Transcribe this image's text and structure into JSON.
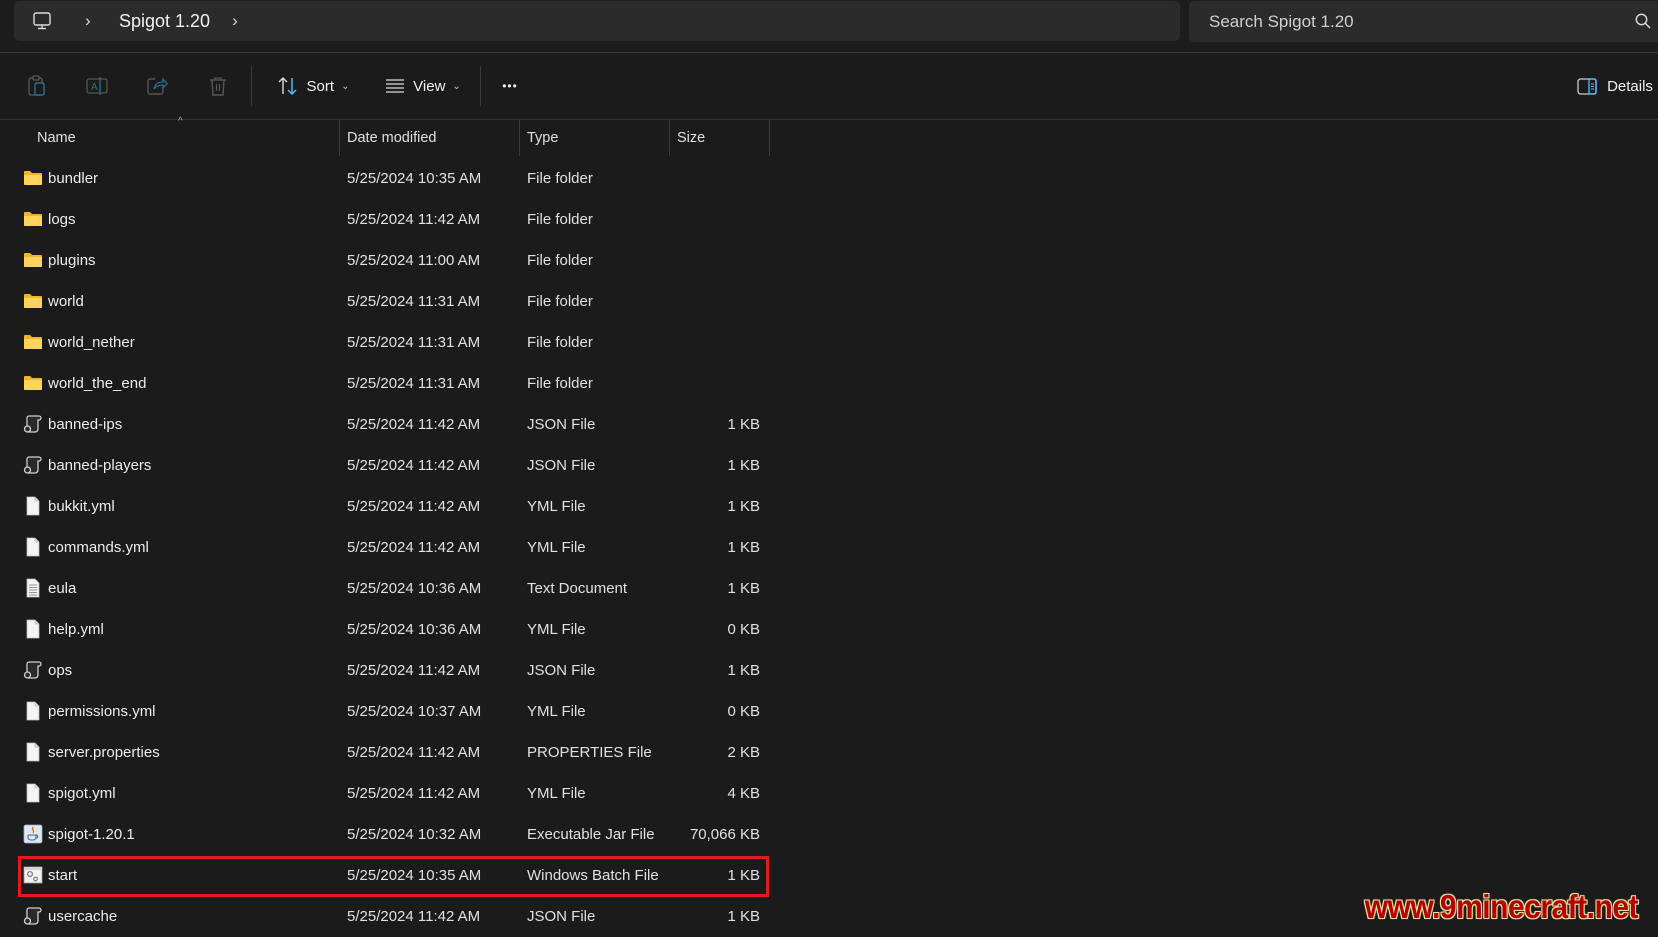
{
  "address_bar": {
    "root_icon": "this-pc-icon",
    "breadcrumb": [
      "Spigot 1.20"
    ],
    "separator": "›"
  },
  "search": {
    "placeholder": "Search Spigot 1.20",
    "value": ""
  },
  "toolbar": {
    "icons": [
      "paste-icon",
      "rename-icon",
      "share-icon",
      "delete-icon"
    ],
    "sort_label": "Sort",
    "view_label": "View",
    "more_label": "•••",
    "details_label": "Details"
  },
  "columns": {
    "name": "Name",
    "date": "Date modified",
    "type": "Type",
    "size": "Size",
    "sort_indicator": "^"
  },
  "files": [
    {
      "name": "bundler",
      "date": "5/25/2024 10:35 AM",
      "type": "File folder",
      "size": "",
      "icon": "folder"
    },
    {
      "name": "logs",
      "date": "5/25/2024 11:42 AM",
      "type": "File folder",
      "size": "",
      "icon": "folder"
    },
    {
      "name": "plugins",
      "date": "5/25/2024 11:00 AM",
      "type": "File folder",
      "size": "",
      "icon": "folder"
    },
    {
      "name": "world",
      "date": "5/25/2024 11:31 AM",
      "type": "File folder",
      "size": "",
      "icon": "folder"
    },
    {
      "name": "world_nether",
      "date": "5/25/2024 11:31 AM",
      "type": "File folder",
      "size": "",
      "icon": "folder"
    },
    {
      "name": "world_the_end",
      "date": "5/25/2024 11:31 AM",
      "type": "File folder",
      "size": "",
      "icon": "folder"
    },
    {
      "name": "banned-ips",
      "date": "5/25/2024 11:42 AM",
      "type": "JSON File",
      "size": "1 KB",
      "icon": "script"
    },
    {
      "name": "banned-players",
      "date": "5/25/2024 11:42 AM",
      "type": "JSON File",
      "size": "1 KB",
      "icon": "script"
    },
    {
      "name": "bukkit.yml",
      "date": "5/25/2024 11:42 AM",
      "type": "YML File",
      "size": "1 KB",
      "icon": "file"
    },
    {
      "name": "commands.yml",
      "date": "5/25/2024 11:42 AM",
      "type": "YML File",
      "size": "1 KB",
      "icon": "file"
    },
    {
      "name": "eula",
      "date": "5/25/2024 10:36 AM",
      "type": "Text Document",
      "size": "1 KB",
      "icon": "text"
    },
    {
      "name": "help.yml",
      "date": "5/25/2024 10:36 AM",
      "type": "YML File",
      "size": "0 KB",
      "icon": "file"
    },
    {
      "name": "ops",
      "date": "5/25/2024 11:42 AM",
      "type": "JSON File",
      "size": "1 KB",
      "icon": "script"
    },
    {
      "name": "permissions.yml",
      "date": "5/25/2024 10:37 AM",
      "type": "YML File",
      "size": "0 KB",
      "icon": "file"
    },
    {
      "name": "server.properties",
      "date": "5/25/2024 11:42 AM",
      "type": "PROPERTIES File",
      "size": "2 KB",
      "icon": "file"
    },
    {
      "name": "spigot.yml",
      "date": "5/25/2024 11:42 AM",
      "type": "YML File",
      "size": "4 KB",
      "icon": "file"
    },
    {
      "name": "spigot-1.20.1",
      "date": "5/25/2024 10:32 AM",
      "type": "Executable Jar File",
      "size": "70,066 KB",
      "icon": "jar"
    },
    {
      "name": "start",
      "date": "5/25/2024 10:35 AM",
      "type": "Windows Batch File",
      "size": "1 KB",
      "icon": "batch",
      "highlighted": true
    },
    {
      "name": "usercache",
      "date": "5/25/2024 11:42 AM",
      "type": "JSON File",
      "size": "1 KB",
      "icon": "script"
    }
  ],
  "highlight_color": "#e01b1b",
  "accent_color": "#4cc2ff",
  "watermark": "www.9minecraft.net"
}
